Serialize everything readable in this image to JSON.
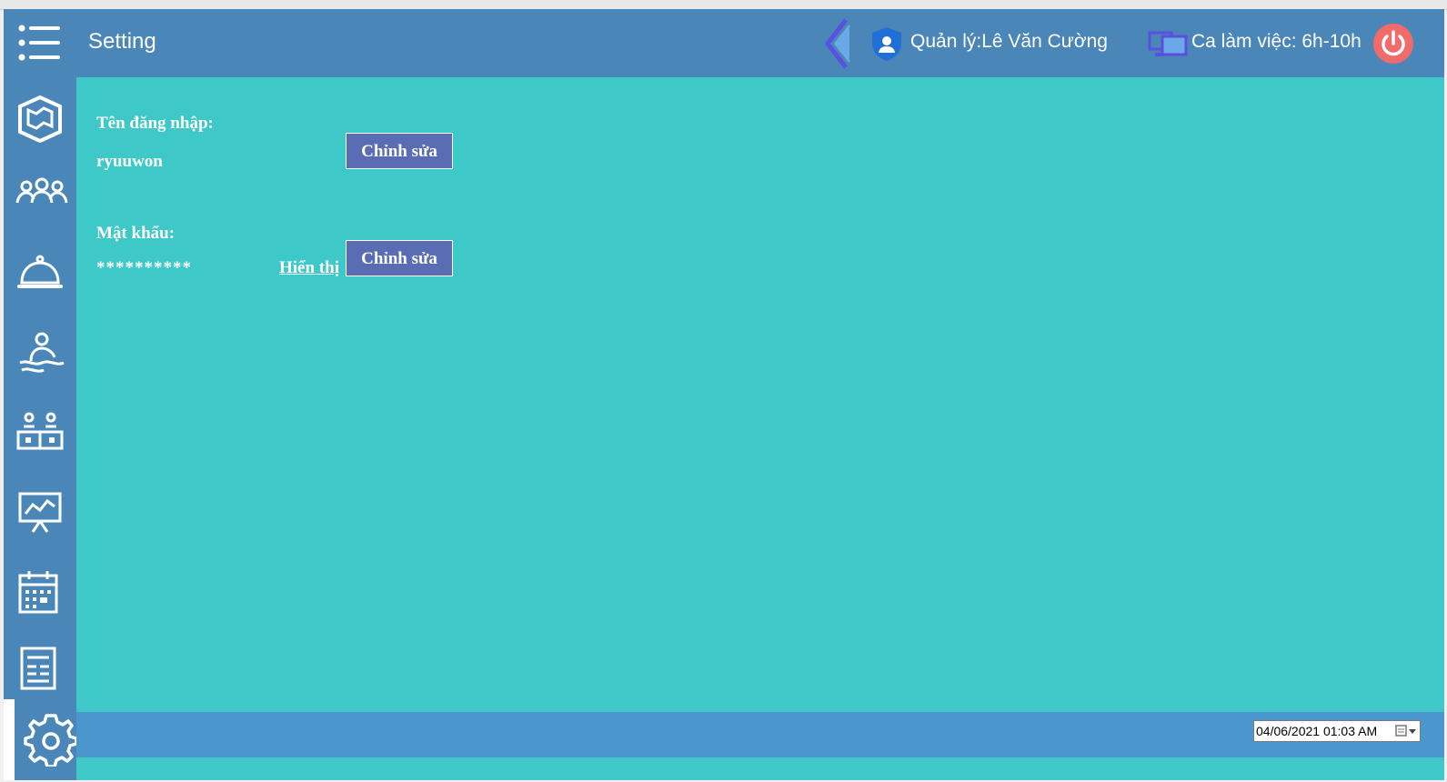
{
  "header": {
    "title": "Setting",
    "manager": "Quản lý:Lê Văn Cường",
    "shift": "Ca làm việc: 6h-10h",
    "icons": [
      "menu-icon",
      "chevron-left-icon",
      "shield-user-icon",
      "monitors-icon",
      "power-icon"
    ]
  },
  "sidebar": {
    "items": [
      {
        "icon": "map-icon"
      },
      {
        "icon": "users-icon"
      },
      {
        "icon": "service-bell-icon"
      },
      {
        "icon": "pool-person-icon"
      },
      {
        "icon": "meeting-room-icon"
      },
      {
        "icon": "presentation-chart-icon"
      },
      {
        "icon": "calendar-icon"
      },
      {
        "icon": "document-icon"
      },
      {
        "icon": "gear-icon",
        "active": true
      }
    ]
  },
  "account": {
    "username_label": "Tên đăng nhập:",
    "username": "ryuuwon",
    "username_edit": "Chỉnh sửa",
    "password_label": "Mật khẩu:",
    "password": "**********",
    "show_password": "Hiển thị",
    "password_edit": "Chỉnh sửa"
  },
  "footer": {
    "datetime": "04/06/2021 01:03 AM"
  },
  "colors": {
    "header": "#4a86b8",
    "content": "#3ec8c8",
    "footer": "#4b96cc",
    "button": "#5a6cb4",
    "power": "#f26b6b"
  }
}
